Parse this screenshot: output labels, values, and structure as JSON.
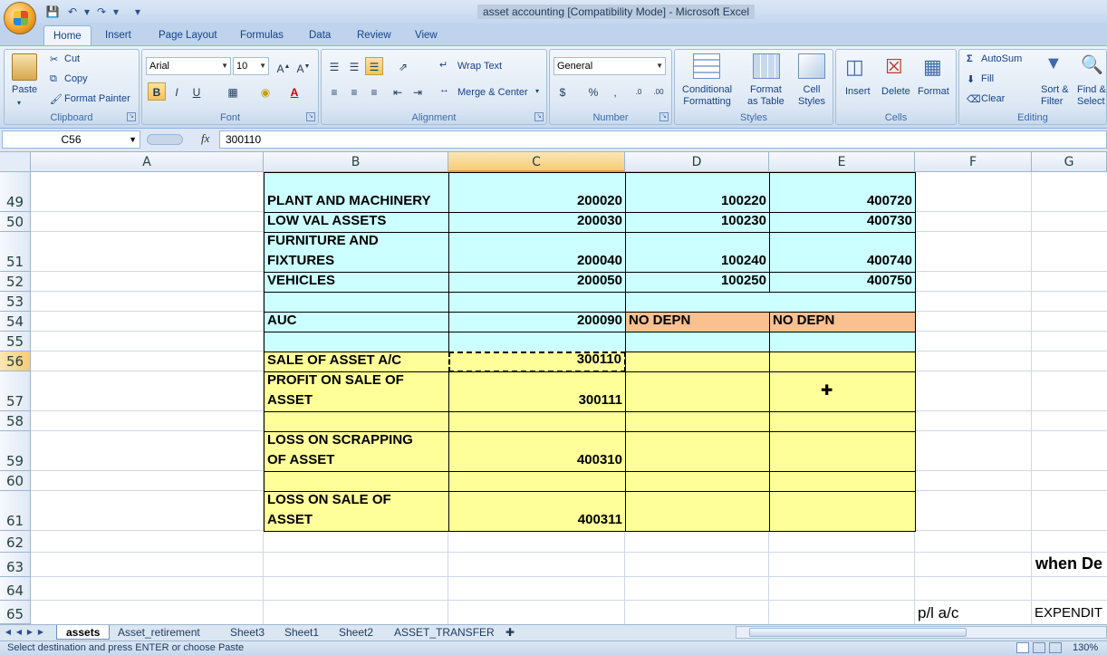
{
  "window": {
    "title": "asset accounting  [Compatibility Mode] - Microsoft Excel"
  },
  "ribbon": {
    "tabs": [
      "Home",
      "Insert",
      "Page Layout",
      "Formulas",
      "Data",
      "Review",
      "View"
    ],
    "clipboard": {
      "paste": "Paste",
      "cut": "Cut",
      "copy": "Copy",
      "format_painter": "Format Painter",
      "label": "Clipboard"
    },
    "font": {
      "name": "Arial",
      "size": "10",
      "label": "Font"
    },
    "alignment": {
      "wrap_text": "Wrap Text",
      "merge_center": "Merge & Center",
      "label": "Alignment"
    },
    "number": {
      "format": "General",
      "label": "Number"
    },
    "styles": {
      "conditional": "Conditional\nFormatting",
      "format_table": "Format\nas Table",
      "cell_styles": "Cell\nStyles",
      "label": "Styles"
    },
    "cells": {
      "insert": "Insert",
      "delete": "Delete",
      "format": "Format",
      "label": "Cells"
    },
    "editing": {
      "autosum": "AutoSum",
      "fill": "Fill",
      "clear": "Clear",
      "sort_filter": "Sort &\nFilter",
      "find_select": "Find &\nSelect",
      "label": "Editing"
    }
  },
  "formula_bar": {
    "name_box": "C56",
    "fx": "fx",
    "value": "300110"
  },
  "columns": [
    "A",
    "B",
    "C",
    "D",
    "E",
    "F",
    "G"
  ],
  "rows": [
    "49",
    "50",
    "51",
    "52",
    "53",
    "54",
    "55",
    "56",
    "57",
    "58",
    "59",
    "60",
    "61",
    "62",
    "63",
    "64",
    "65"
  ],
  "cells": {
    "B49": "PLANT AND MACHINERY",
    "C49": "200020",
    "D49": "100220",
    "E49": "400720",
    "B50": "LOW VAL ASSETS",
    "C50": "200030",
    "D50": "100230",
    "E50": "400730",
    "B51": "FURNITURE AND\nFIXTURES",
    "C51": "200040",
    "D51": "100240",
    "E51": "400740",
    "B52": "VEHICLES",
    "C52": "200050",
    "D52": "100250",
    "E52": "400750",
    "B54": "AUC",
    "C54": "200090",
    "D54": "NO DEPN",
    "E54": "NO DEPN",
    "B56": "SALE OF ASSET A/C",
    "C56": "300110",
    "B57": "PROFIT ON SALE OF\nASSET",
    "C57": "300111",
    "B59": "LOSS ON SCRAPPING\nOF ASSET",
    "C59": "400310",
    "B61": "LOSS ON SALE OF\nASSET",
    "C61": "400311",
    "G63": "when De",
    "F65": "p/l a/c",
    "G65": "EXPENDIT"
  },
  "sheet_tabs": [
    "assets",
    "Asset_retirement",
    "Sheet3",
    "Sheet1",
    "Sheet2",
    "ASSET_TRANSFER"
  ],
  "status": {
    "message": "Select destination and press ENTER or choose Paste",
    "zoom": "130%"
  },
  "colors": {
    "cyan_fill": "#ccffff",
    "orange_fill": "#fac090",
    "yellow_fill": "#ffff99",
    "ribbon_blue": "#dbe6f4"
  }
}
